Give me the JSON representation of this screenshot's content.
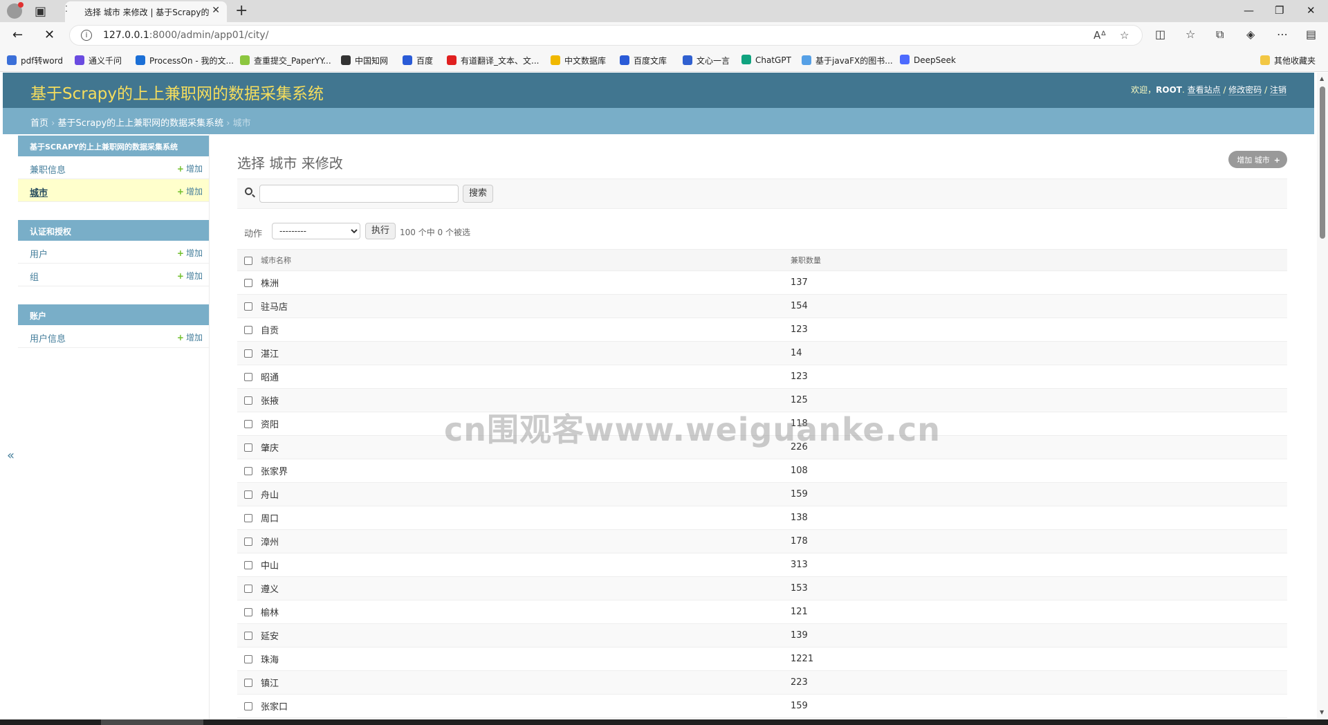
{
  "browser": {
    "tab_title": "选择 城市 来修改 | 基于Scrapy的上上兼职网的数据采集系统",
    "url_host": "127.0.0.1",
    "url_rest": ":8000/admin/app01/city/",
    "bookmarks": [
      {
        "label": "pdf转word",
        "color": "#3b6fd8"
      },
      {
        "label": "通义千问",
        "color": "#6a4be0"
      },
      {
        "label": "ProcessOn - 我的文...",
        "color": "#1b6fd6"
      },
      {
        "label": "查重提交_PaperYY...",
        "color": "#8cc63f"
      },
      {
        "label": "中国知网",
        "color": "#333333"
      },
      {
        "label": "百度",
        "color": "#2a5bd7"
      },
      {
        "label": "有道翻译_文本、文...",
        "color": "#e02020"
      },
      {
        "label": "中文数据库",
        "color": "#f0b800"
      },
      {
        "label": "百度文库",
        "color": "#2a5bd7"
      },
      {
        "label": "文心一言",
        "color": "#3060d0"
      },
      {
        "label": "ChatGPT",
        "color": "#10a37f"
      },
      {
        "label": "基于javaFX的图书...",
        "color": "#56a0e6"
      },
      {
        "label": "DeepSeek",
        "color": "#4d6bfe"
      }
    ],
    "other_bookmarks": "其他收藏夹"
  },
  "header": {
    "site_title": "基于Scrapy的上上兼职网的数据采集系统",
    "welcome": "欢迎，",
    "username": "ROOT",
    "view_site": "查看站点",
    "change_password": "修改密码",
    "logout": "注销"
  },
  "breadcrumbs": {
    "home": "首页",
    "app": "基于Scrapy的上上兼职网的数据采集系统",
    "current": "城市"
  },
  "sidebar": {
    "add_label": "增加",
    "modules": [
      {
        "caption": "基于Scrapy的上上兼职网的数据采集系统",
        "items": [
          {
            "name": "兼职信息"
          },
          {
            "name": "城市"
          }
        ]
      },
      {
        "caption": "认证和授权",
        "items": [
          {
            "name": "用户"
          },
          {
            "name": "组"
          }
        ]
      },
      {
        "caption": "账户",
        "items": [
          {
            "name": "用户信息"
          }
        ]
      }
    ]
  },
  "content": {
    "title": "选择 城市 来修改",
    "add_button": "增加 城市",
    "search_button": "搜索",
    "action_label": "动作",
    "action_default": "---------",
    "go_button": "执行",
    "selection_count": "100 个中 0 个被选",
    "columns": [
      "城市名称",
      "兼职数量"
    ],
    "rows": [
      [
        "株洲",
        "137"
      ],
      [
        "驻马店",
        "154"
      ],
      [
        "自贡",
        "123"
      ],
      [
        "湛江",
        "14"
      ],
      [
        "昭通",
        "123"
      ],
      [
        "张掖",
        "125"
      ],
      [
        "资阳",
        "118"
      ],
      [
        "肇庆",
        "226"
      ],
      [
        "张家界",
        "108"
      ],
      [
        "舟山",
        "159"
      ],
      [
        "周口",
        "138"
      ],
      [
        "漳州",
        "178"
      ],
      [
        "中山",
        "313"
      ],
      [
        "遵义",
        "153"
      ],
      [
        "榆林",
        "121"
      ],
      [
        "延安",
        "139"
      ],
      [
        "珠海",
        "1221"
      ],
      [
        "镇江",
        "223"
      ],
      [
        "张家口",
        "159"
      ]
    ]
  },
  "watermark": "cn围观客www.weiguanke.cn"
}
